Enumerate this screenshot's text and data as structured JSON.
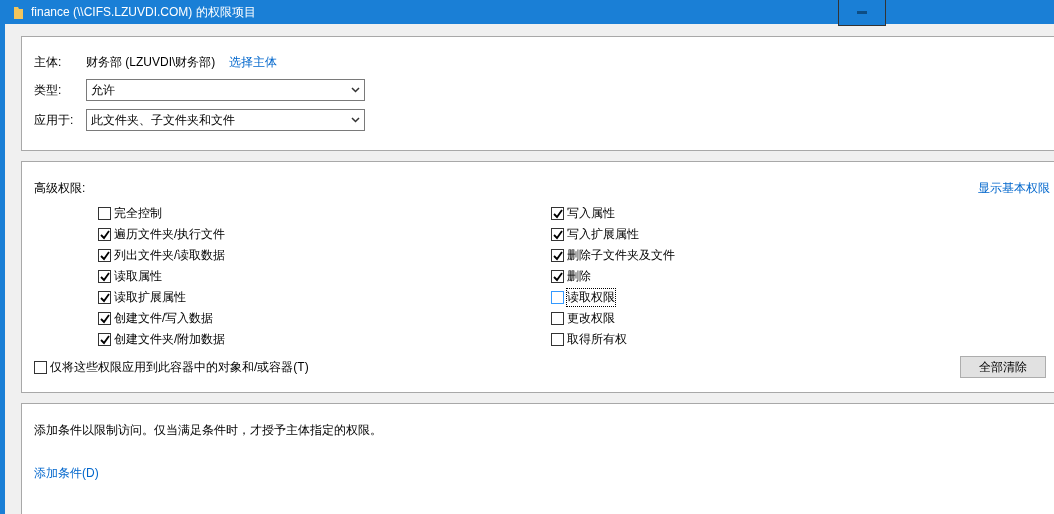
{
  "window": {
    "title": "finance (\\\\CIFS.LZUVDI.COM) 的权限项目"
  },
  "principal": {
    "label": "主体:",
    "value": "财务部 (LZUVDI\\财务部)",
    "link": "选择主体"
  },
  "fields": [
    {
      "label": "类型:",
      "value": "允许"
    },
    {
      "label": "应用于:",
      "value": "此文件夹、子文件夹和文件"
    }
  ],
  "permissions": {
    "title": "高级权限:",
    "link": "显示基本权限",
    "columns": [
      [
        {
          "label": "完全控制",
          "checked": false,
          "focused": false
        },
        {
          "label": "遍历文件夹/执行文件",
          "checked": true,
          "focused": false
        },
        {
          "label": "列出文件夹/读取数据",
          "checked": true,
          "focused": false
        },
        {
          "label": "读取属性",
          "checked": true,
          "focused": false
        },
        {
          "label": "读取扩展属性",
          "checked": true,
          "focused": false
        },
        {
          "label": "创建文件/写入数据",
          "checked": true,
          "focused": false
        },
        {
          "label": "创建文件夹/附加数据",
          "checked": true,
          "focused": false
        }
      ],
      [
        {
          "label": "写入属性",
          "checked": true,
          "focused": false
        },
        {
          "label": "写入扩展属性",
          "checked": true,
          "focused": false
        },
        {
          "label": "删除子文件夹及文件",
          "checked": true,
          "focused": false
        },
        {
          "label": "删除",
          "checked": true,
          "focused": false
        },
        {
          "label": "读取权限",
          "checked": false,
          "focused": true
        },
        {
          "label": "更改权限",
          "checked": false,
          "focused": false
        },
        {
          "label": "取得所有权",
          "checked": false,
          "focused": false
        }
      ]
    ],
    "apply_only": {
      "label": "仅将这些权限应用到此容器中的对象和/或容器(T)",
      "checked": false
    },
    "clear_button": "全部清除"
  },
  "conditions": {
    "text": "添加条件以限制访问。仅当满足条件时，才授予主体指定的权限。",
    "link": "添加条件(D)"
  }
}
